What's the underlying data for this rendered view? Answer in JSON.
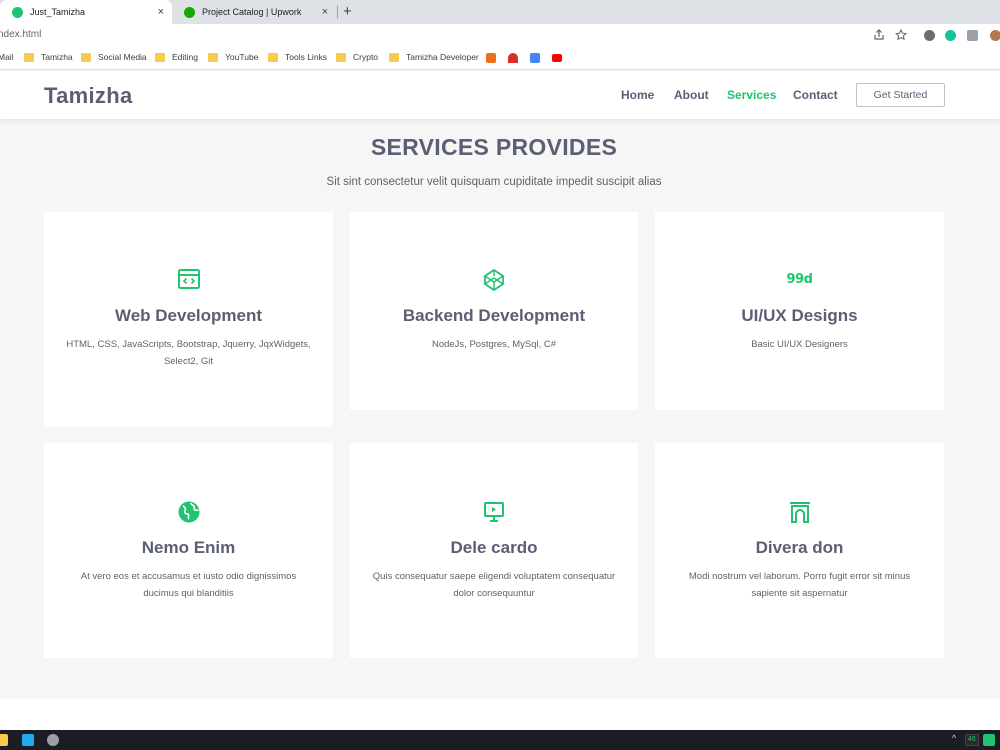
{
  "browser": {
    "tabs": [
      {
        "title": "Just_Tamizha",
        "active": true,
        "icon_color": "#20c36f"
      },
      {
        "title": "Project Catalog | Upwork",
        "active": false,
        "icon_color": "#14a800"
      }
    ],
    "tab_close_glyph": "×",
    "new_tab_glyph": "+",
    "url": "ndex.html",
    "bookmarks": [
      "Mail",
      "Tamizha",
      "Social Media",
      "Editing",
      "YouTube",
      "Tools Links",
      "Crypto",
      "Tamizha Developer"
    ],
    "colors": {
      "tab_strip": "#dee1e6",
      "folder": "#f7cb4d"
    }
  },
  "site": {
    "logo": "Tamizha",
    "nav": [
      {
        "label": "Home",
        "active": false
      },
      {
        "label": "About",
        "active": false
      },
      {
        "label": "Services",
        "active": true
      },
      {
        "label": "Contact",
        "active": false
      }
    ],
    "cta": "Get Started",
    "accent_color": "#20c36f",
    "text_color": "#5b5f73"
  },
  "services": {
    "title": "SERVICES PROVIDES",
    "subtitle": "Sit sint consectetur velit quisquam cupiditate impedit suscipit alias",
    "cards": [
      {
        "icon": "code-window-icon",
        "title": "Web Development",
        "desc": "HTML, CSS, JavaScripts, Bootstrap, Jquerry, JqxWidgets, Select2, Git"
      },
      {
        "icon": "codepen-cube-icon",
        "title": "Backend Development",
        "desc": "NodeJs, Postgres, MySql, C#"
      },
      {
        "icon": "99designs-logo-icon",
        "title": "UI/UX Designs",
        "desc": "Basic UI/UX Designers",
        "icon_text": "99d"
      },
      {
        "icon": "globe-icon",
        "title": "Nemo Enim",
        "desc": "At vero eos et accusamus et iusto odio dignissimos ducimus qui blanditiis"
      },
      {
        "icon": "presentation-play-icon",
        "title": "Dele cardo",
        "desc": "Quis consequatur saepe eligendi voluptatem consequatur dolor consequuntur"
      },
      {
        "icon": "arch-gate-icon",
        "title": "Divera don",
        "desc": "Modi nostrum vel laborum. Porro fugit error sit minus sapiente sit aspernatur"
      }
    ]
  },
  "taskbar": {
    "tray_badge": "46"
  }
}
